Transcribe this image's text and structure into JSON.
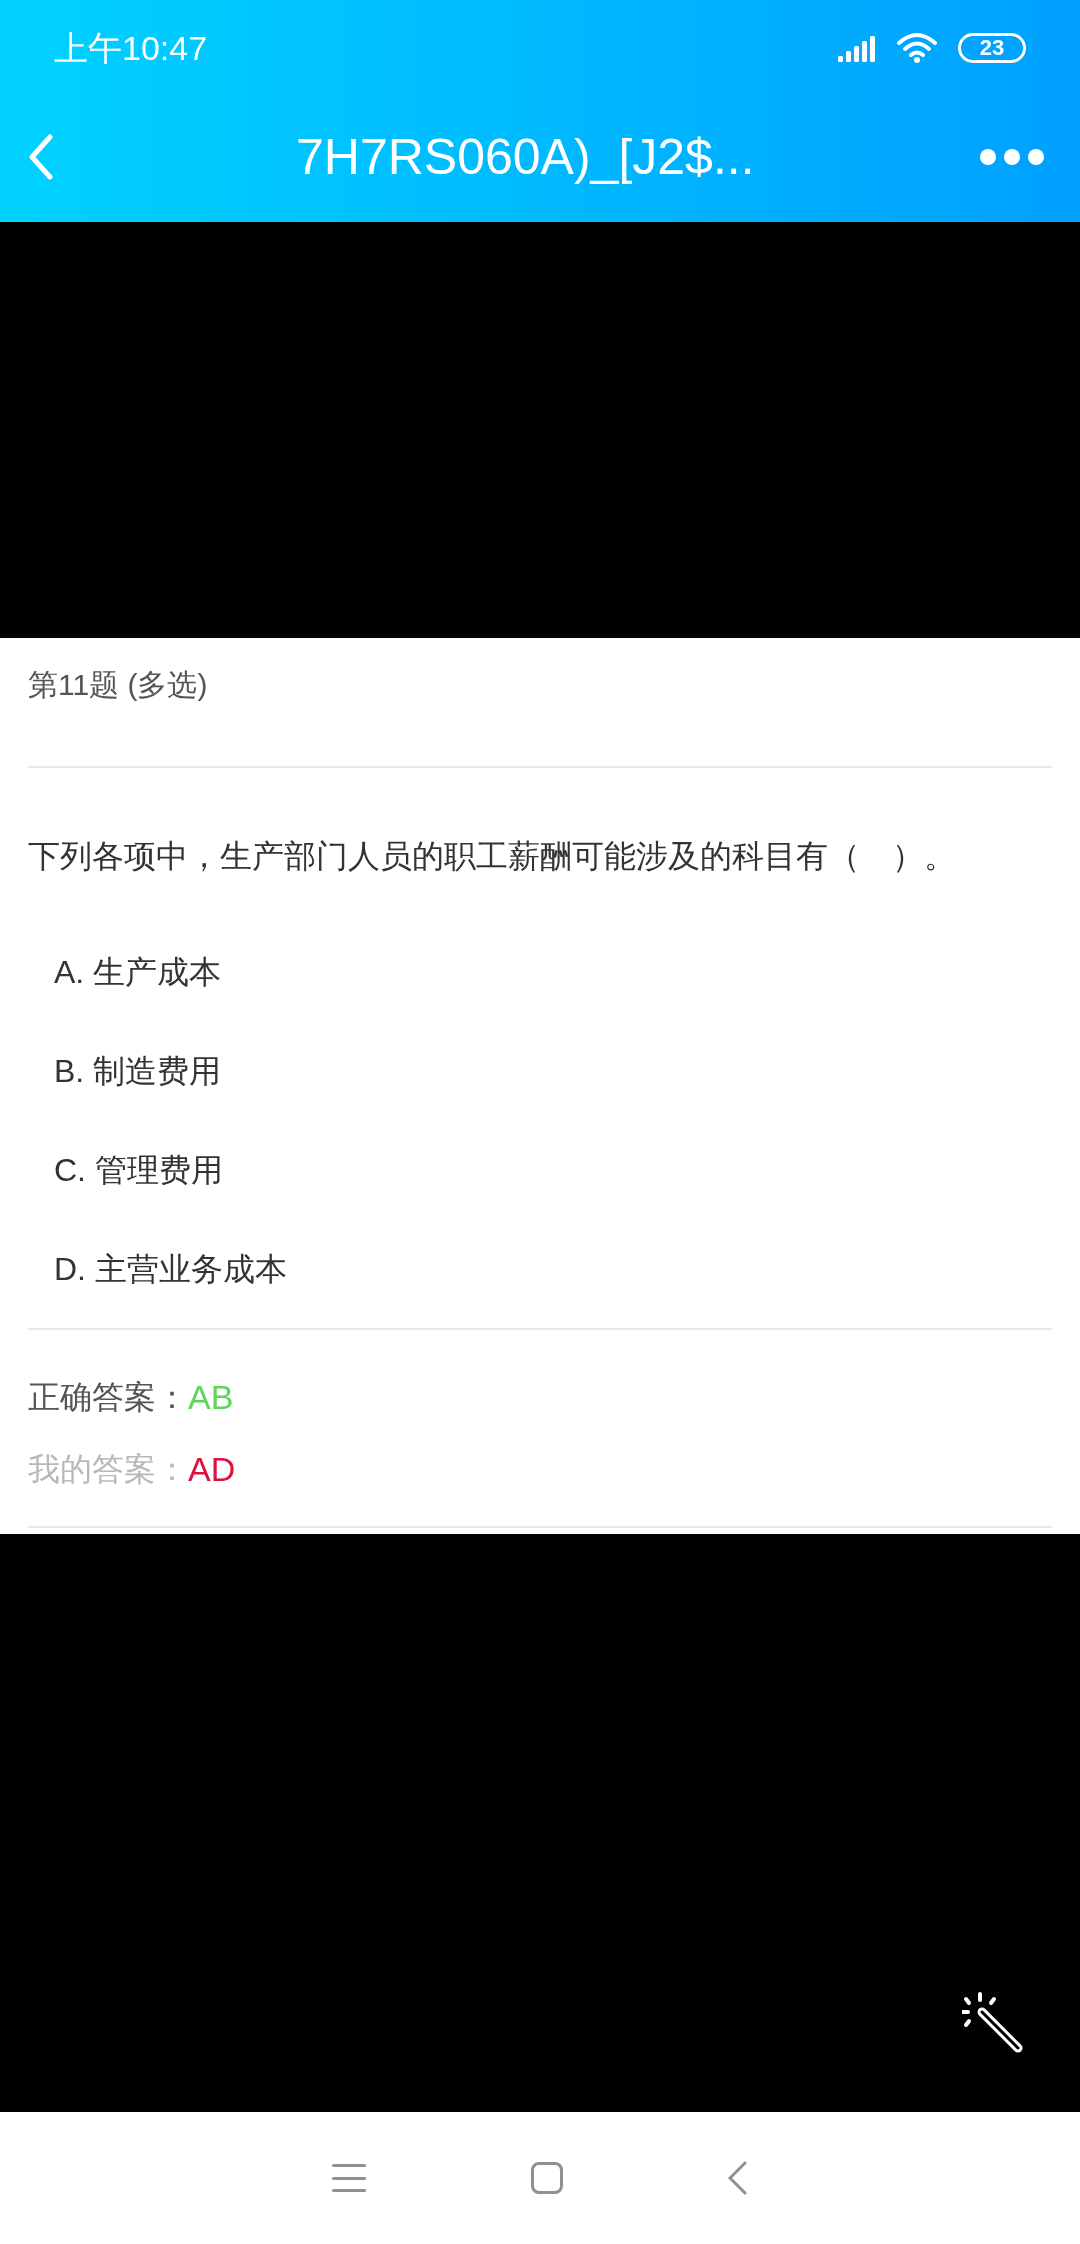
{
  "status_bar": {
    "time": "上午10:47",
    "battery": "23"
  },
  "header": {
    "title": "7H7RS060A)_[J2$..."
  },
  "question": {
    "number_label": "第11题 (多选)",
    "text": "下列各项中，生产部门人员的职工薪酬可能涉及的科目有（　）。",
    "options": [
      {
        "label": "A. 生产成本"
      },
      {
        "label": "B. 制造费用"
      },
      {
        "label": "C. 管理费用"
      },
      {
        "label": "D. 主营业务成本"
      }
    ]
  },
  "answers": [
    {
      "kind": "correct",
      "label": "正确答案：",
      "value": "AB"
    },
    {
      "kind": "mine",
      "label": "我的答案：",
      "value": "AD"
    }
  ]
}
